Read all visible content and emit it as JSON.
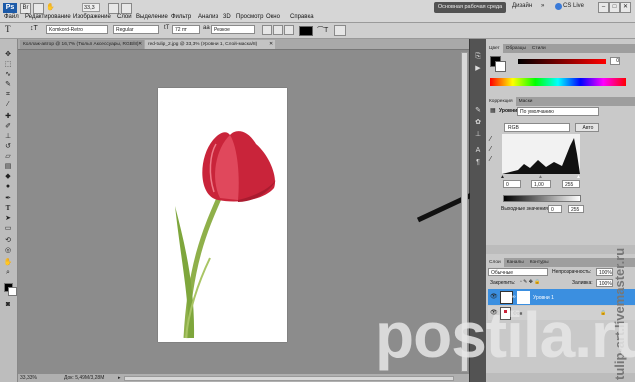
{
  "app": {
    "logo": "Ps",
    "menu": [
      "Файл",
      "Редактирование",
      "Изображение",
      "Слои",
      "Выделение",
      "Фильтр",
      "Анализ",
      "3D",
      "Просмотр",
      "Окно",
      "Справка"
    ],
    "zoom": "33,3",
    "workspace": "Основная рабочая среда",
    "design": "Дизайн",
    "cslive": "CS Live"
  },
  "options": {
    "font_family": "Komkord-Retro",
    "font_style": "Regular",
    "font_size": "72 пт",
    "antialias": "Резкое"
  },
  "doc_tabs": [
    "Коллаж-автор @ 16,7% (Тюльп Аксессуары, RGB/8)",
    "red-tulip_2.jpg @ 33,3% (Уровни 1, Слой-маска/8)"
  ],
  "status": {
    "zoom": "33,33%",
    "doc": "Док: 5,49M/3,28M"
  },
  "color_panel": {
    "tabs": [
      "Цвет",
      "Образцы",
      "Стили"
    ],
    "r_value": "0"
  },
  "adjust_panel": {
    "tabs": [
      "Коррекция",
      "Маски"
    ],
    "title": "Уровни",
    "preset": "По умолчанию",
    "channel": "RGB",
    "auto": "Авто",
    "input_black": "0",
    "input_mid": "1,00",
    "input_white": "255",
    "output_label": "Выходные значения:",
    "output_black": "0",
    "output_white": "255"
  },
  "layers_panel": {
    "tabs": [
      "Слои",
      "Каналы",
      "Контуры"
    ],
    "blend": "Обычные",
    "opacity_label": "Непрозрачность:",
    "opacity": "100%",
    "lock_label": "Закрепить:",
    "fill_label": "Заливка:",
    "fill": "100%",
    "layers": [
      {
        "name": "Уровни 1",
        "selected": true
      },
      {
        "name": "Фон",
        "selected": false
      }
    ]
  },
  "watermark": {
    "side": "tulip-art.livemaster.ru",
    "main": "postila.ru"
  },
  "colors": {
    "selection": "#3b8fe0",
    "tulip": "#d12f45",
    "stem": "#9fbe5a"
  }
}
